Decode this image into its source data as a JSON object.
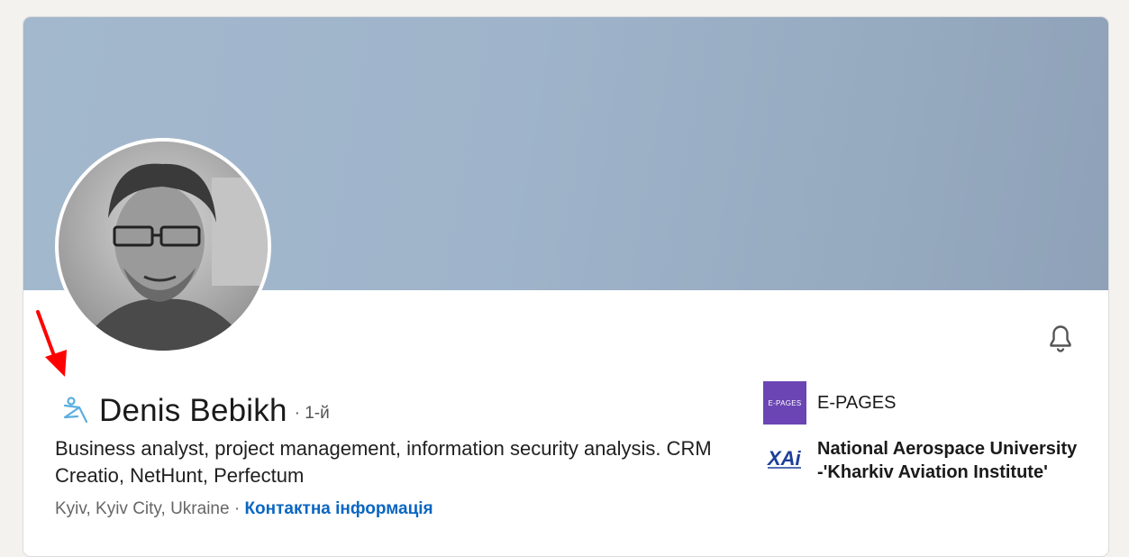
{
  "profile": {
    "name": "Denis Bebikh",
    "degree": "· 1-й",
    "headline": "Business analyst, project management, information security analysis. CRM Creatio, NetHunt, Perfectum",
    "location": "Kyiv, Kyiv City, Ukraine",
    "separator": " · ",
    "contact_link": "Контактна інформація"
  },
  "experience": {
    "company": "E-PAGES",
    "company_logo_text": "E-PAGES"
  },
  "education": {
    "school": "National Aerospace University -'Kharkiv Aviation Institute'"
  },
  "icons": {
    "bell": "bell-icon",
    "name_badge": "open-to-work-person-icon",
    "annotation": "red-arrow-icon",
    "school_logo": "xai-logo-icon"
  },
  "colors": {
    "link": "#0a66c2",
    "company_logo_bg": "#6b45b3",
    "banner": "#9fb4ca",
    "annotation_arrow": "#ff0000"
  }
}
